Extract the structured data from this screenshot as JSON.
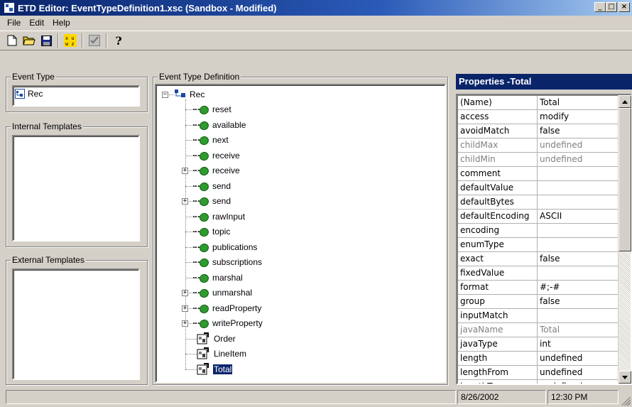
{
  "window": {
    "title": "ETD Editor: EventTypeDefinition1.xsc (Sandbox - Modified)",
    "buttons": [
      "_",
      "□",
      "×"
    ]
  },
  "menu": [
    "File",
    "Edit",
    "Help"
  ],
  "toolbar": {
    "icons": [
      "new-file-icon",
      "open-folder-icon",
      "save-icon",
      "compile-icon",
      "checkmark-icon",
      "help-icon"
    ]
  },
  "event_type": {
    "label": "Event Type",
    "item": "Rec"
  },
  "internal_templates": {
    "label": "Internal Templates"
  },
  "external_templates": {
    "label": "External Templates"
  },
  "etd": {
    "label": "Event Type Definition",
    "root": "Rec",
    "nodes": [
      {
        "label": "reset",
        "kind": "method",
        "expandable": false
      },
      {
        "label": "available",
        "kind": "method",
        "expandable": false
      },
      {
        "label": "next",
        "kind": "method",
        "expandable": false
      },
      {
        "label": "receive",
        "kind": "method",
        "expandable": false
      },
      {
        "label": "receive",
        "kind": "method",
        "expandable": true
      },
      {
        "label": "send",
        "kind": "method",
        "expandable": false
      },
      {
        "label": "send",
        "kind": "method",
        "expandable": true
      },
      {
        "label": "rawInput",
        "kind": "method",
        "expandable": false
      },
      {
        "label": "topic",
        "kind": "method",
        "expandable": false
      },
      {
        "label": "publications",
        "kind": "method",
        "expandable": false
      },
      {
        "label": "subscriptions",
        "kind": "method",
        "expandable": false
      },
      {
        "label": "marshal",
        "kind": "method",
        "expandable": false
      },
      {
        "label": "unmarshal",
        "kind": "method",
        "expandable": true
      },
      {
        "label": "readProperty",
        "kind": "method",
        "expandable": true
      },
      {
        "label": "writeProperty",
        "kind": "method",
        "expandable": true
      },
      {
        "label": "Order",
        "kind": "class",
        "expandable": false
      },
      {
        "label": "LineItem",
        "kind": "class",
        "expandable": false
      },
      {
        "label": "Total",
        "kind": "class",
        "expandable": false,
        "selected": true
      }
    ]
  },
  "properties": {
    "title": "Properties -Total",
    "rows": [
      {
        "name": "(Name)",
        "value": "Total",
        "disabled": false
      },
      {
        "name": "access",
        "value": "modify",
        "disabled": false
      },
      {
        "name": "avoidMatch",
        "value": "false",
        "disabled": false
      },
      {
        "name": "childMax",
        "value": "undefined",
        "disabled": true
      },
      {
        "name": "childMin",
        "value": "undefined",
        "disabled": true
      },
      {
        "name": "comment",
        "value": "",
        "disabled": false
      },
      {
        "name": "defaultValue",
        "value": "",
        "disabled": false
      },
      {
        "name": "defaultBytes",
        "value": "",
        "disabled": false
      },
      {
        "name": "defaultEncoding",
        "value": "ASCII",
        "disabled": false
      },
      {
        "name": "encoding",
        "value": "",
        "disabled": false
      },
      {
        "name": "enumType",
        "value": "",
        "disabled": false
      },
      {
        "name": "exact",
        "value": "false",
        "disabled": false
      },
      {
        "name": "fixedValue",
        "value": "",
        "disabled": false
      },
      {
        "name": "format",
        "value": "#;-#",
        "disabled": false
      },
      {
        "name": "group",
        "value": "false",
        "disabled": false
      },
      {
        "name": "inputMatch",
        "value": "",
        "disabled": false
      },
      {
        "name": "javaName",
        "value": "Total",
        "disabled": true
      },
      {
        "name": "javaType",
        "value": "int",
        "disabled": false
      },
      {
        "name": "length",
        "value": "undefined",
        "disabled": false
      },
      {
        "name": "lengthFrom",
        "value": "undefined",
        "disabled": false
      },
      {
        "name": "lengthTo",
        "value": "undefined",
        "disabled": false
      }
    ]
  },
  "status": {
    "message": "",
    "date": "8/26/2002",
    "time": "12:30 PM"
  },
  "colors": {
    "titlebar": "#0a246a",
    "selection": "#0a246a",
    "face": "#d4d0c8"
  }
}
